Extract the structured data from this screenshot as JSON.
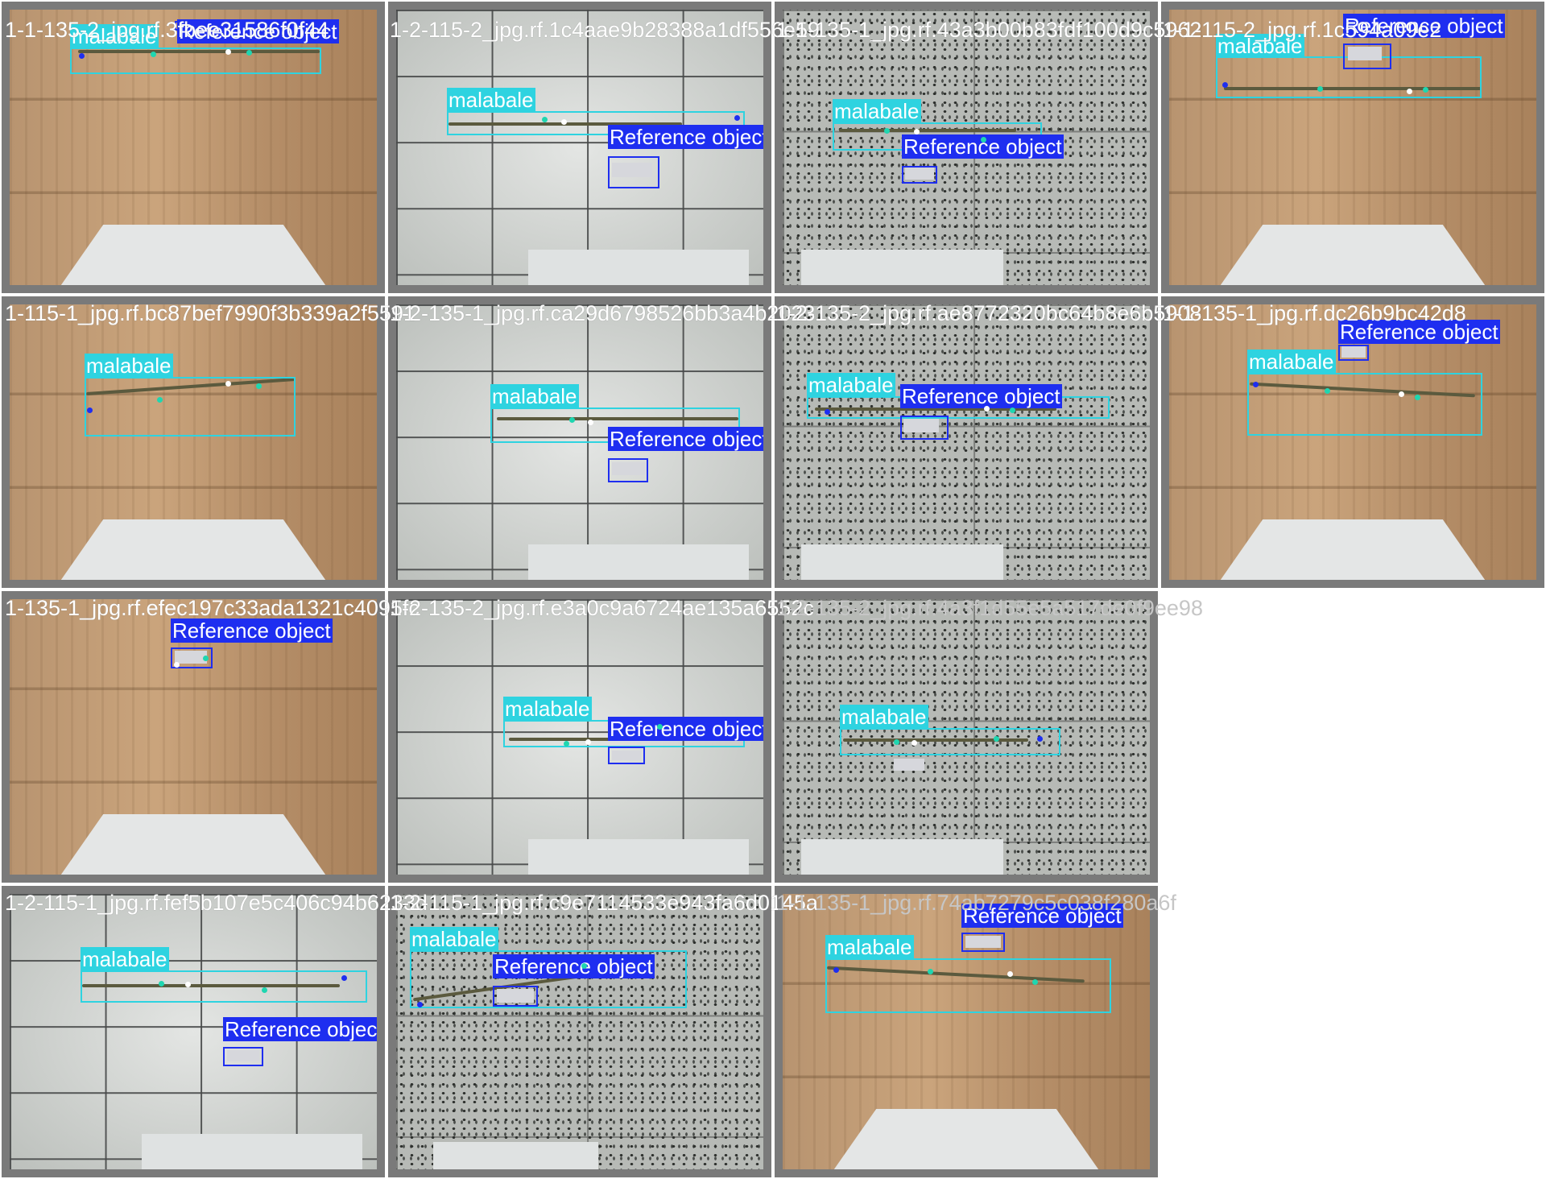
{
  "labels": {
    "plant": "malabale",
    "reference": "Reference object"
  },
  "colors": {
    "plant_box": "#2ed3e0",
    "reference_box": "#1e2ef0",
    "keypoint_blue": "#1e2ef0",
    "keypoint_green": "#1fd6b0",
    "keypoint_white": "#ffffff"
  },
  "filenames": [
    "1-1-135-2_jpg.rf.3fbee31586f0f44",
    "1-2-115-2_jpg.rf.1c4aae9b28388a1df556e59",
    "1-1-135-1_jpg.rf.43a3b00b83fdf100d9c5962",
    "1-1-115-2_jpg.rf.1c594a09e2",
    "1-115-1_jpg.rf.bc87bef7990f3b339a2f5591",
    "1-2-135-1_jpg.rf.ca29d6798526bb3a4b2023",
    "1-2-135-2_jpg.rf.ae8772320bc64b8e6b5908",
    "1-1-135-1_jpg.rf.dc26b9bc42d8",
    "1-135-1_jpg.rf.efec197c33ada1321c4095fc",
    "1-2-135-2_jpg.rf.e3a0c9a6724ae135a6552c",
    "1-2-135-2_jpg.rf.4a3f1d55e5a517de0f9ee98",
    "1-2-115-1_jpg.rf.fef5b107e5c406c94b6233d",
    "1-2-115-1_jpg.rf.c9e7114533e943fa6d0145a",
    "1-1-135-1_jpg.rf.74ab7279c5c038f280a6f"
  ]
}
